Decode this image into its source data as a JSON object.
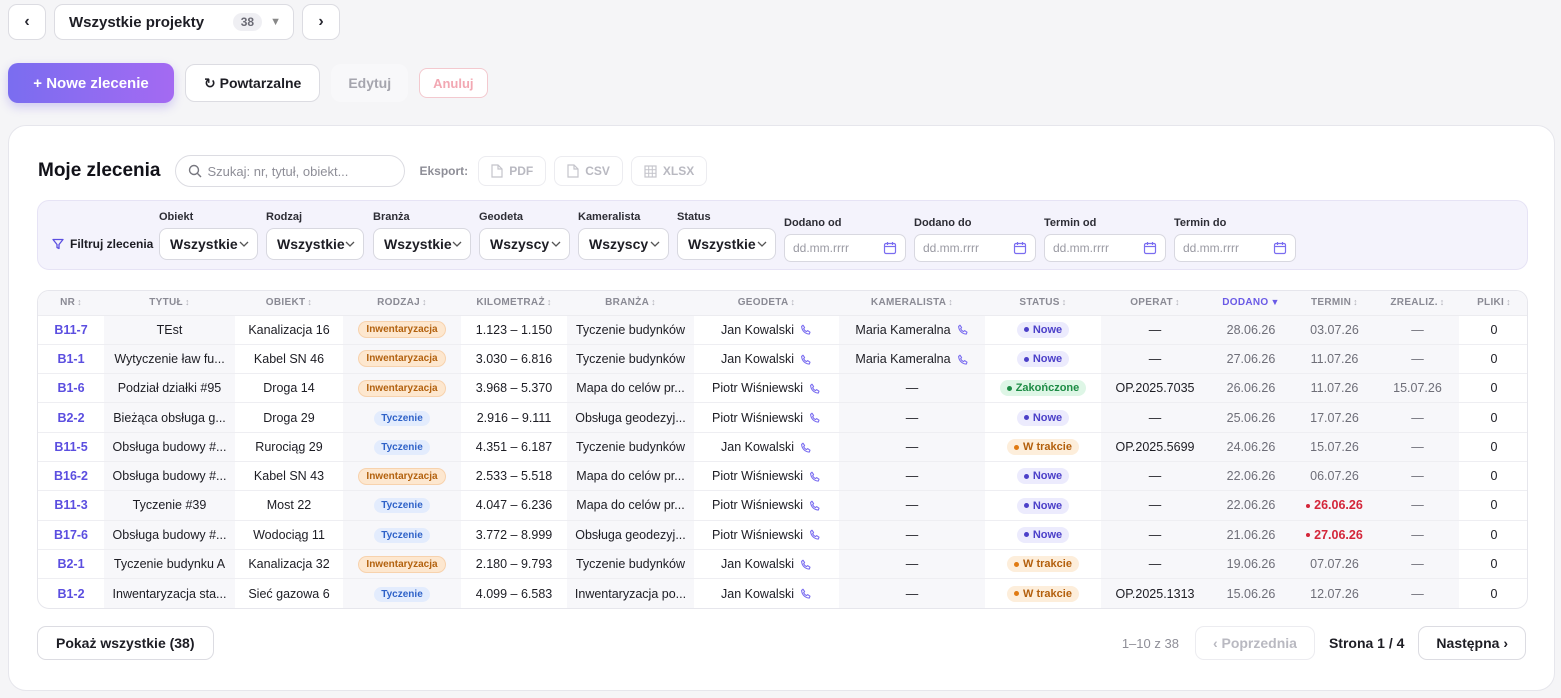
{
  "project_nav": {
    "prev": "‹",
    "next": "›",
    "project_title": "Wszystkie projekty",
    "project_count": "38",
    "caret": "▼"
  },
  "actions": {
    "new": "+ Nowe zlecenie",
    "recurring": "↻ Powtarzalne",
    "edit": "Edytuj",
    "cancel": "Anuluj"
  },
  "orders": {
    "title": "Moje zlecenia",
    "search_placeholder": "Szukaj: nr, tytuł, obiekt...",
    "export_label": "Eksport:",
    "export_buttons": [
      "PDF",
      "CSV",
      "XLSX"
    ]
  },
  "filters": {
    "main_label": "Filtruj zlecenia",
    "selects": [
      {
        "label": "Obiekt",
        "value": "Wszystkie"
      },
      {
        "label": "Rodzaj",
        "value": "Wszystkie"
      },
      {
        "label": "Branża",
        "value": "Wszystkie"
      },
      {
        "label": "Geodeta",
        "value": "Wszyscy"
      },
      {
        "label": "Kameralista",
        "value": "Wszyscy"
      },
      {
        "label": "Status",
        "value": "Wszystkie"
      }
    ],
    "dates": [
      {
        "label": "Dodano od",
        "placeholder": "dd.mm.rrrr"
      },
      {
        "label": "Dodano do",
        "placeholder": "dd.mm.rrrr"
      },
      {
        "label": "Termin od",
        "placeholder": "dd.mm.rrrr"
      },
      {
        "label": "Termin do",
        "placeholder": "dd.mm.rrrr"
      }
    ]
  },
  "table": {
    "headers": [
      "NR",
      "TYTUŁ",
      "OBIEKT",
      "RODZAJ",
      "KILOMETRAŻ",
      "BRANŻA",
      "GEODETA",
      "KAMERALISTA",
      "STATUS",
      "OPERAT",
      "DODANO",
      "TERMIN",
      "ZREALIZ.",
      "PLIKI"
    ],
    "sort_icon": "↕",
    "active_sort_icon": "▼",
    "rows": [
      {
        "nr": "B11-7",
        "title": "TEst",
        "object": "Kanalizacja 16",
        "type": "Inwentaryzacja",
        "km": "1.123 – 1.150",
        "branch": "Tyczenie budynków",
        "geodeta": "Jan Kowalski",
        "kameralista": "Maria Kameralna",
        "status": "Nowe",
        "operat": "—",
        "added": "28.06.26",
        "deadline": "03.07.26",
        "late": false,
        "done": "—",
        "files": "0"
      },
      {
        "nr": "B1-1",
        "title": "Wytyczenie ław fu...",
        "object": "Kabel SN 46",
        "type": "Inwentaryzacja",
        "km": "3.030 – 6.816",
        "branch": "Tyczenie budynków",
        "geodeta": "Jan Kowalski",
        "kameralista": "Maria Kameralna",
        "status": "Nowe",
        "operat": "—",
        "added": "27.06.26",
        "deadline": "11.07.26",
        "late": false,
        "done": "—",
        "files": "0"
      },
      {
        "nr": "B1-6",
        "title": "Podział działki #95",
        "object": "Droga 14",
        "type": "Inwentaryzacja",
        "km": "3.968 – 5.370",
        "branch": "Mapa do celów pr...",
        "geodeta": "Piotr Wiśniewski",
        "kameralista": "—",
        "status": "Zakończone",
        "operat": "OP.2025.7035",
        "added": "26.06.26",
        "deadline": "11.07.26",
        "late": false,
        "done": "15.07.26",
        "files": "0"
      },
      {
        "nr": "B2-2",
        "title": "Bieżąca obsługa g...",
        "object": "Droga 29",
        "type": "Tyczenie",
        "km": "2.916 – 9.111",
        "branch": "Obsługa geodezyj...",
        "geodeta": "Piotr Wiśniewski",
        "kameralista": "—",
        "status": "Nowe",
        "operat": "—",
        "added": "25.06.26",
        "deadline": "17.07.26",
        "late": false,
        "done": "—",
        "files": "0"
      },
      {
        "nr": "B11-5",
        "title": "Obsługa budowy #...",
        "object": "Rurociąg 29",
        "type": "Tyczenie",
        "km": "4.351 – 6.187",
        "branch": "Tyczenie budynków",
        "geodeta": "Jan Kowalski",
        "kameralista": "—",
        "status": "W trakcie",
        "operat": "OP.2025.5699",
        "added": "24.06.26",
        "deadline": "15.07.26",
        "late": false,
        "done": "—",
        "files": "0"
      },
      {
        "nr": "B16-2",
        "title": "Obsługa budowy #...",
        "object": "Kabel SN 43",
        "type": "Inwentaryzacja",
        "km": "2.533 – 5.518",
        "branch": "Mapa do celów pr...",
        "geodeta": "Piotr Wiśniewski",
        "kameralista": "—",
        "status": "Nowe",
        "operat": "—",
        "added": "22.06.26",
        "deadline": "06.07.26",
        "late": false,
        "done": "—",
        "files": "0"
      },
      {
        "nr": "B11-3",
        "title": "Tyczenie #39",
        "object": "Most 22",
        "type": "Tyczenie",
        "km": "4.047 – 6.236",
        "branch": "Mapa do celów pr...",
        "geodeta": "Piotr Wiśniewski",
        "kameralista": "—",
        "status": "Nowe",
        "operat": "—",
        "added": "22.06.26",
        "deadline": "26.06.26",
        "late": true,
        "done": "—",
        "files": "0"
      },
      {
        "nr": "B17-6",
        "title": "Obsługa budowy #...",
        "object": "Wodociąg 11",
        "type": "Tyczenie",
        "km": "3.772 – 8.999",
        "branch": "Obsługa geodezyj...",
        "geodeta": "Piotr Wiśniewski",
        "kameralista": "—",
        "status": "Nowe",
        "operat": "—",
        "added": "21.06.26",
        "deadline": "27.06.26",
        "late": true,
        "done": "—",
        "files": "0"
      },
      {
        "nr": "B2-1",
        "title": "Tyczenie budynku A",
        "object": "Kanalizacja 32",
        "type": "Inwentaryzacja",
        "km": "2.180 – 9.793",
        "branch": "Tyczenie budynków",
        "geodeta": "Jan Kowalski",
        "kameralista": "—",
        "status": "W trakcie",
        "operat": "—",
        "added": "19.06.26",
        "deadline": "07.07.26",
        "late": false,
        "done": "—",
        "files": "0"
      },
      {
        "nr": "B1-2",
        "title": "Inwentaryzacja sta...",
        "object": "Sieć gazowa 6",
        "type": "Tyczenie",
        "km": "4.099 – 6.583",
        "branch": "Inwentaryzacja po...",
        "geodeta": "Jan Kowalski",
        "kameralista": "—",
        "status": "W trakcie",
        "operat": "OP.2025.1313",
        "added": "15.06.26",
        "deadline": "12.07.26",
        "late": false,
        "done": "—",
        "files": "0"
      }
    ]
  },
  "footer": {
    "show_all": "Pokaż wszystkie (38)",
    "range": "1–10 z 38",
    "prev": "‹ Poprzednia",
    "page": "Strona 1 / 4",
    "next": "Następna ›"
  },
  "colors": {
    "accent": "#6a5ae6",
    "late": "#d4263a"
  }
}
